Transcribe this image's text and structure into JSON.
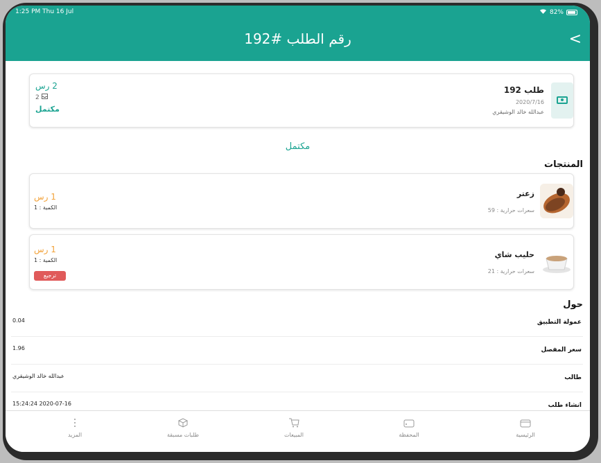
{
  "status_bar": {
    "time": "1:25 PM  Thu 16 Jul",
    "battery": "82%"
  },
  "header": {
    "title": "رقم الطلب #192",
    "back_glyph": "<"
  },
  "order": {
    "name": "طلب 192",
    "date": "2020/7/16",
    "customer": "عبدالله خالد الوشيقري",
    "price": "2 رس",
    "items_count": "2",
    "status": "مكتمل"
  },
  "order_status_label": "مكتمل",
  "products_title": "المنتجات",
  "products": [
    {
      "name": "زعتر",
      "calories": "سعرات حرارية : 59",
      "price": "1 رس",
      "qty": "الكمية : 1"
    },
    {
      "name": "حليب شاي",
      "calories": "سعرات حرارية : 21",
      "price": "1 رس",
      "qty": "الكمية : 1",
      "refund_label": "ترجيع"
    }
  ],
  "about_title": "حول",
  "about_rows": [
    {
      "label": "عمولة التطبيق",
      "value": "0.04"
    },
    {
      "label": "سعر المفصل",
      "value": "1.96"
    },
    {
      "label": "طالب",
      "value": "عبدالله خالد الوشيقري"
    },
    {
      "label": "انشاء طلب",
      "value": "2020-07-16 15:24:24"
    }
  ],
  "tabs": [
    {
      "label": "الرئيسية",
      "icon": "home-icon"
    },
    {
      "label": "المحفظة",
      "icon": "wallet-icon"
    },
    {
      "label": "المبيعات",
      "icon": "cart-icon"
    },
    {
      "label": "طلبات مسبقة",
      "icon": "box-icon"
    },
    {
      "label": "المزيد",
      "icon": "more-icon"
    }
  ],
  "colors": {
    "accent": "#1aa391",
    "price": "#f2a23a",
    "danger": "#e05a5a"
  }
}
